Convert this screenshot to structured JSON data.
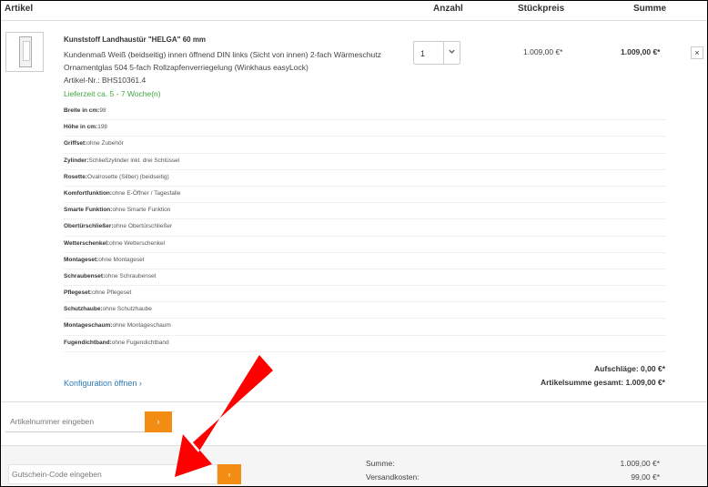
{
  "header": {
    "artikel": "Artikel",
    "anzahl": "Anzahl",
    "stueckpreis": "Stückpreis",
    "summe": "Summe"
  },
  "product": {
    "title": "Kunststoff Landhaustür \"HELGA\" 60 mm",
    "description": "Kundenmaß Weiß (beidseitig) innen öffnend DIN links (Sicht von innen) 2-fach Wärmeschutz Ornamentglas 504 5-fach Rollzapfenverriegelung (Winkhaus easyLock)",
    "sku": "Artikel-Nr.: BHS10361.4",
    "delivery": "Lieferzeit ca. 5 - 7 Woche(n)",
    "quantity": "1",
    "unit_price": "1.009,00 €*",
    "line_total": "1.009,00 €*",
    "remove": "×",
    "options": [
      {
        "label": "Breite in cm:",
        "value": "98"
      },
      {
        "label": "Höhe in cm:",
        "value": "198"
      },
      {
        "label": "Griffset:",
        "value": "ohne Zubehör"
      },
      {
        "label": "Zylinder:",
        "value": "Schließzylinder inkl. drei Schlüssel"
      },
      {
        "label": "Rosette:",
        "value": "Ovalrosette (Silber) (beidseitig)"
      },
      {
        "label": "Komfortfunktion:",
        "value": "ohne E-Öffner / Tagesfalle"
      },
      {
        "label": "Smarte Funktion:",
        "value": "ohne Smarte Funktion"
      },
      {
        "label": "Obertürschließer:",
        "value": "ohne Obertürschließer"
      },
      {
        "label": "Wetterschenkel:",
        "value": "ohne Wetterschenkel"
      },
      {
        "label": "Montageset:",
        "value": "ohne Montageset"
      },
      {
        "label": "Schraubenset:",
        "value": "ohne Schraubenset"
      },
      {
        "label": "Pflegeset:",
        "value": "ohne Pflegeset"
      },
      {
        "label": "Schutzhaube:",
        "value": "ohne Schutzhaube"
      },
      {
        "label": "Montageschaum:",
        "value": "ohne Montageschaum"
      },
      {
        "label": "Fugendichtband:",
        "value": "ohne Fugendichtband"
      }
    ],
    "surcharge": "Aufschläge:  0,00 €*",
    "article_sum": "Artikelsumme gesamt:  1.009,00 €*",
    "configure": "Konfiguration öffnen ›"
  },
  "article_entry": {
    "placeholder": "Artikelnummer eingeben",
    "button": "›"
  },
  "footer": {
    "coupon_placeholder": "Gutschein-Code eingeben",
    "coupon_button": "›",
    "sum_label": "Summe:",
    "sum_value": "1.009,00 €*",
    "shipping_label": "Versandkosten:",
    "shipping_value": "99,00 €*"
  },
  "colors": {
    "accent_orange": "#f28c13",
    "link_blue": "#2a7ab7",
    "delivery_green": "#3fa83f",
    "annotation_arrow": "#ff0000"
  }
}
